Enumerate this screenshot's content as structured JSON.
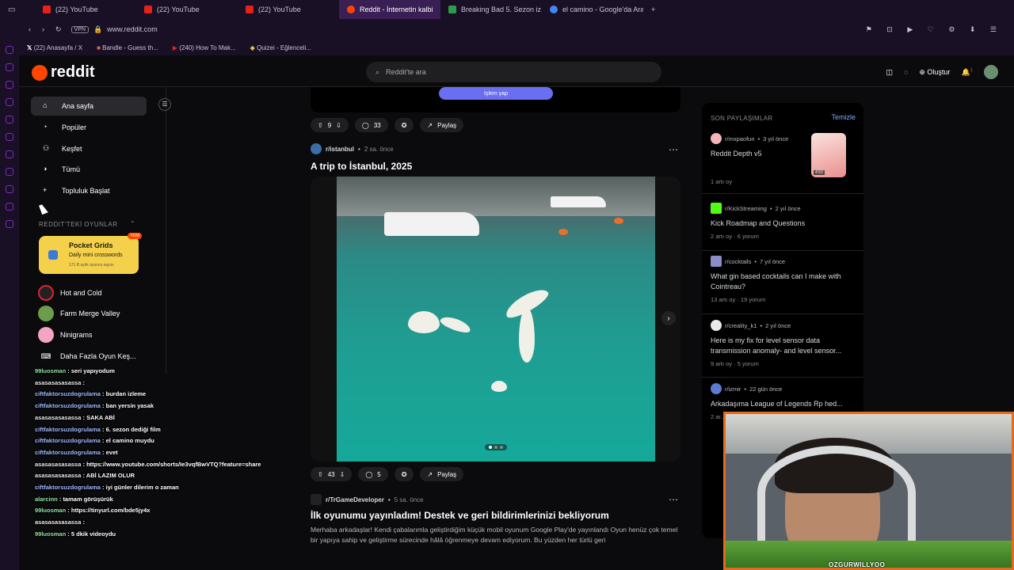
{
  "browser": {
    "tabs": [
      {
        "label": "(22) YouTube",
        "color": "#e62117"
      },
      {
        "label": "(22) YouTube",
        "color": "#e62117"
      },
      {
        "label": "(22) YouTube",
        "color": "#e62117"
      },
      {
        "label": "Reddit - İnternetin kalbi",
        "color": "#ff4500"
      },
      {
        "label": "Breaking Bad 5. Sezon iz...",
        "color": "#2d9b4a"
      },
      {
        "label": "el camino - Google'da Ara",
        "color": "#4285f4"
      }
    ],
    "vpn": "VPN",
    "url": "www.reddit.com",
    "bookmarks": [
      "(22) Anasayfa / X",
      "Bandle - Guess th...",
      "(240) How To Mak...",
      "Quizei - Eğlenceli..."
    ]
  },
  "reddit": {
    "logo": "reddit",
    "search_placeholder": "Reddit'te ara",
    "create_label": "Oluştur",
    "notif_count": "1"
  },
  "sidebar": {
    "nav": [
      "Ana sayfa",
      "Popüler",
      "Keşfet",
      "Tümü",
      "Topluluk Başlat"
    ],
    "games_header": "REDDIT'TEKİ OYUNLAR",
    "featured_game": {
      "name": "Pocket Grids",
      "desc": "Daily mini crosswords",
      "players": "171 B aylık oyuncu sayısı",
      "badge": "YENİ"
    },
    "games": [
      "Hot and Cold",
      "Farm Merge Valley",
      "Ninigrams",
      "Daha Fazla Oyun Keş..."
    ]
  },
  "chat": [
    {
      "user": "99luosman",
      "msg": "seri yapıyodum",
      "c": "u"
    },
    {
      "user": "asasasasasassa",
      "msg": "",
      "c": "u3"
    },
    {
      "user": "ciftfaktorsuzdogrulama",
      "msg": "burdan izleme",
      "c": "u2"
    },
    {
      "user": "ciftfaktorsuzdogrulama",
      "msg": "ban yersin yasak",
      "c": "u2"
    },
    {
      "user": "asasasasasassa",
      "msg": "SAKA ABİ",
      "c": "u3"
    },
    {
      "user": "ciftfaktorsuzdogrulama",
      "msg": "6. sezon dediği film",
      "c": "u2"
    },
    {
      "user": "ciftfaktorsuzdogrulama",
      "msg": "el camino muydu",
      "c": "u2"
    },
    {
      "user": "ciftfaktorsuzdogrulama",
      "msg": "evet",
      "c": "u2"
    },
    {
      "user": "asasasasasassa",
      "msg": "https://www.youtube.com/shorts/Ie3vqfBwVTQ?feature=share",
      "c": "u3"
    },
    {
      "user": "asasasasasassa",
      "msg": "ABİ LAZIM OLUR",
      "c": "u3"
    },
    {
      "user": "ciftfaktorsuzdogrulama",
      "msg": "iyi günler dilerim o zaman",
      "c": "u2"
    },
    {
      "user": "alarcinn",
      "msg": "tamam görüşürük",
      "c": "u"
    },
    {
      "user": "99luosman",
      "msg": "https://tinyurl.com/bde5jy4x",
      "c": "u"
    },
    {
      "user": "asasasasasassa",
      "msg": "",
      "c": "u3"
    },
    {
      "user": "99luosman",
      "msg": "5 dkik videoydu",
      "c": "u"
    }
  ],
  "feed": {
    "top_button": "İşlem yap",
    "post1_actions": {
      "votes": "9",
      "comments": "33",
      "share": "Paylaş"
    },
    "post2": {
      "sub": "r/istanbul",
      "time": "2 sa. önce",
      "title": "A trip to İstanbul, 2025",
      "votes": "43",
      "comments": "5",
      "share": "Paylaş"
    },
    "post3": {
      "sub": "r/TrGameDeveloper",
      "time": "5 sa. önce",
      "title": "İlk oyunumu yayınladım! Destek ve geri bildirimlerinizi bekliyorum",
      "body": "Merhaba arkadaşlar! Kendi çabalarımla geliştirdiğim küçük mobil oyunum Google Play'de yayınlandı Oyun henüz çok temel bir yapıya sahip ve geliştirme sürecinde hâlâ öğrenmeye devam ediyorum. Bu yüzden her türlü geri"
    }
  },
  "recent": {
    "header": "SON PAYLAŞIMLAR",
    "clear": "Temizle",
    "items": [
      {
        "sub": "r/mxpaofun",
        "time": "3 yıl önce",
        "title": "Reddit Depth v5",
        "stats": "1 artı oy",
        "icon_color": "#f3b5b5",
        "duration": "4:53"
      },
      {
        "sub": "r/KickStreaming",
        "time": "2 yıl önce",
        "title": "Kick Roadmap and Questions",
        "stats": "2 artı oy · 6 yorum",
        "icon_color": "#53fc18"
      },
      {
        "sub": "r/cocktails",
        "time": "7 yıl önce",
        "title": "What gin based cocktails can I make with Cointreau?",
        "stats": "13 artı oy · 19 yorum",
        "icon_color": "#8a8dc9"
      },
      {
        "sub": "r/creality_k1",
        "time": "2 yıl önce",
        "title": "Here is my fix for level sensor data transmission anomaly- and level sensor...",
        "stats": "9 artı oy · 5 yorum",
        "icon_color": "#eaeaea"
      },
      {
        "sub": "r/izmir",
        "time": "22 gün önce",
        "title": "Arkadaşıma League of Legends Rp hed...",
        "stats": "2 ar...",
        "icon_color": "#5c7bd0"
      }
    ]
  },
  "webcam": {
    "name": "OZGURWILLYOO"
  }
}
